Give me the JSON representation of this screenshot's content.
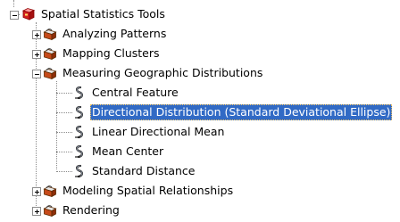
{
  "tree": {
    "root": {
      "label": "Spatial Statistics Tools",
      "icon": "red-toolbox-icon",
      "expanded": true
    },
    "toolsets": [
      {
        "label": "Analyzing Patterns",
        "icon": "toolbox-icon",
        "expanded": false
      },
      {
        "label": "Mapping Clusters",
        "icon": "toolbox-icon",
        "expanded": false
      },
      {
        "label": "Measuring Geographic Distributions",
        "icon": "toolbox-icon",
        "expanded": true,
        "tools": [
          {
            "label": "Central Feature",
            "icon": "script-tool-icon",
            "selected": false
          },
          {
            "label": "Directional Distribution (Standard Deviational Ellipse)",
            "icon": "script-tool-icon",
            "selected": true
          },
          {
            "label": "Linear Directional Mean",
            "icon": "script-tool-icon",
            "selected": false
          },
          {
            "label": "Mean Center",
            "icon": "script-tool-icon",
            "selected": false
          },
          {
            "label": "Standard Distance",
            "icon": "script-tool-icon",
            "selected": false
          }
        ]
      },
      {
        "label": "Modeling Spatial Relationships",
        "icon": "toolbox-icon",
        "expanded": false
      },
      {
        "label": "Rendering",
        "icon": "toolbox-icon",
        "expanded": false
      }
    ]
  },
  "colors": {
    "selection_bg": "#316ac5",
    "selection_text": "#ffffff",
    "toolbox_red": "#d21e1e"
  }
}
